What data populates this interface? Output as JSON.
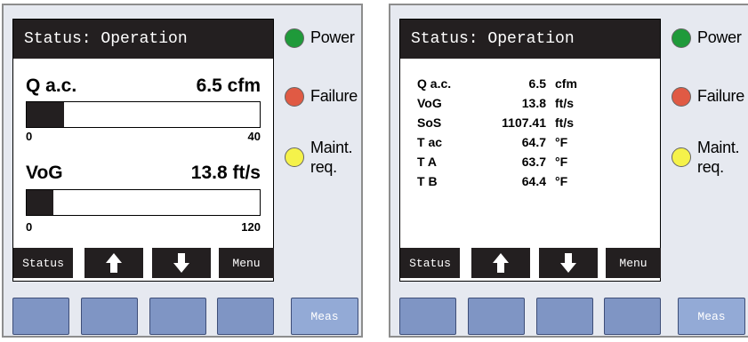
{
  "left_panel": {
    "title": "Status: Operation",
    "measurements": [
      {
        "label": "Q a.c.",
        "value": "6.5 cfm",
        "scale_min": "0",
        "scale_max": "40",
        "fill_fraction": 0.16
      },
      {
        "label": "VoG",
        "value": "13.8 ft/s",
        "scale_min": "0",
        "scale_max": "120",
        "fill_fraction": 0.115
      }
    ],
    "softkeys": {
      "status": "Status",
      "up": "up-arrow-icon",
      "down": "down-arrow-icon",
      "menu": "Menu"
    },
    "leds": {
      "power": "Power",
      "failure": "Failure",
      "maint_1": "Maint.",
      "maint_2": "req."
    },
    "hw_keys": {
      "meas": "Meas"
    }
  },
  "right_panel": {
    "title": "Status: Operation",
    "rows": [
      {
        "label": "Q a.c.",
        "value": "6.5",
        "unit": "cfm"
      },
      {
        "label": "VoG",
        "value": "13.8",
        "unit": "ft/s"
      },
      {
        "label": "SoS",
        "value": "1107.41",
        "unit": "ft/s"
      },
      {
        "label": "T ac",
        "value": "64.7",
        "unit": "°F"
      },
      {
        "label": "T A",
        "value": "63.7",
        "unit": "°F"
      },
      {
        "label": "T B",
        "value": "64.4",
        "unit": "°F"
      }
    ],
    "softkeys": {
      "status": "Status",
      "up": "up-arrow-icon",
      "down": "down-arrow-icon",
      "menu": "Menu"
    },
    "leds": {
      "power": "Power",
      "failure": "Failure",
      "maint_1": "Maint.",
      "maint_2": "req."
    },
    "hw_keys": {
      "meas": "Meas"
    }
  },
  "colors": {
    "power_led": "#1f9a3a",
    "failure_led": "#e05a44",
    "maint_led": "#f5f24a",
    "key_blue": "#7f95c4"
  }
}
